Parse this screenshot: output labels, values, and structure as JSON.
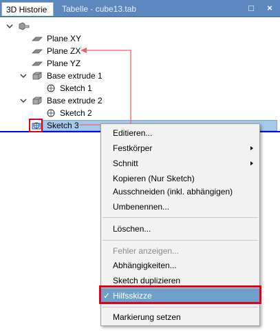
{
  "tabs": [
    {
      "label": "3D Historie",
      "active": true
    },
    {
      "label": "Tabelle - cube13.tab",
      "active": false
    }
  ],
  "window_buttons": {
    "restore": "□",
    "close": "×"
  },
  "tree": {
    "root_icon": "feature-root-icon",
    "items": [
      {
        "label": "Plane XY",
        "icon": "plane-icon"
      },
      {
        "label": "Plane ZX",
        "icon": "plane-icon"
      },
      {
        "label": "Plane YZ",
        "icon": "plane-icon"
      },
      {
        "label": "Base extrude 1",
        "icon": "extrude-icon",
        "expanded": true
      },
      {
        "label": "Sketch 1",
        "icon": "sketch-icon"
      },
      {
        "label": "Base extrude 2",
        "icon": "extrude-icon",
        "expanded": true
      },
      {
        "label": "Sketch 2",
        "icon": "sketch-icon"
      },
      {
        "label": "Sketch 3",
        "icon": "sketch-construction-icon",
        "selected": true
      }
    ]
  },
  "context_menu": {
    "items": [
      {
        "label": "Editieren..."
      },
      {
        "label": "Festkörper",
        "submenu": true
      },
      {
        "label": "Schnitt",
        "submenu": true
      },
      {
        "label": "Kopieren (Nur Sketch)"
      },
      {
        "label": "Ausschneiden (inkl. abhängigen)"
      },
      {
        "label": "Umbenennen..."
      },
      {
        "label": "Löschen..."
      },
      {
        "label": "Fehler anzeigen...",
        "disabled": true
      },
      {
        "label": "Abhängigkeiten..."
      },
      {
        "label": "Sketch duplizieren"
      },
      {
        "label": "Hilfsskizze",
        "checked": true
      },
      {
        "label": "Markierung setzen"
      }
    ],
    "check_mark": "✓"
  },
  "annotation_color": "#e0001b",
  "selection_color": "#a6c8ea"
}
